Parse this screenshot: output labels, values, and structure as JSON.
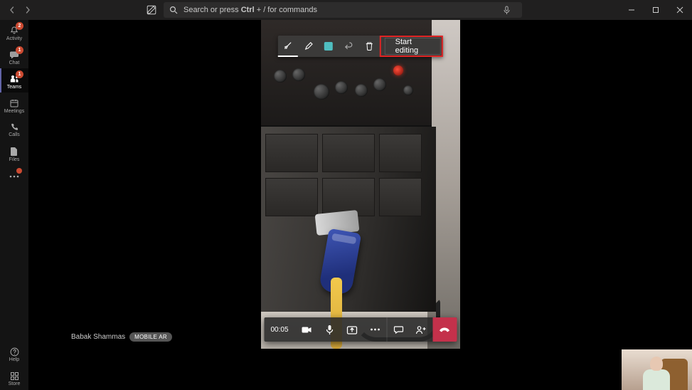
{
  "search": {
    "placeholder_html": "Search or press <b>Ctrl</b> + / for commands"
  },
  "rail": {
    "items": [
      {
        "id": "activity",
        "label": "Activity",
        "badge": "2"
      },
      {
        "id": "chat",
        "label": "Chat",
        "badge": "1"
      },
      {
        "id": "teams",
        "label": "Teams",
        "badge": "1",
        "active": true
      },
      {
        "id": "meetings",
        "label": "Meetings"
      },
      {
        "id": "calls",
        "label": "Calls"
      },
      {
        "id": "files",
        "label": "Files"
      }
    ],
    "help_label": "Help",
    "store_label": "Store"
  },
  "video_toolbar": {
    "pointer_icon": "ink-pointer-icon",
    "pen_icon": "pen-icon",
    "square_icon": "shape-square-icon",
    "undo_icon": "undo-icon",
    "delete_icon": "delete-icon",
    "start_editing_label": "Start editing"
  },
  "call_bar": {
    "duration": "00:05"
  },
  "participant": {
    "name": "Babak Shammas",
    "badge": "MOBILE AR"
  }
}
